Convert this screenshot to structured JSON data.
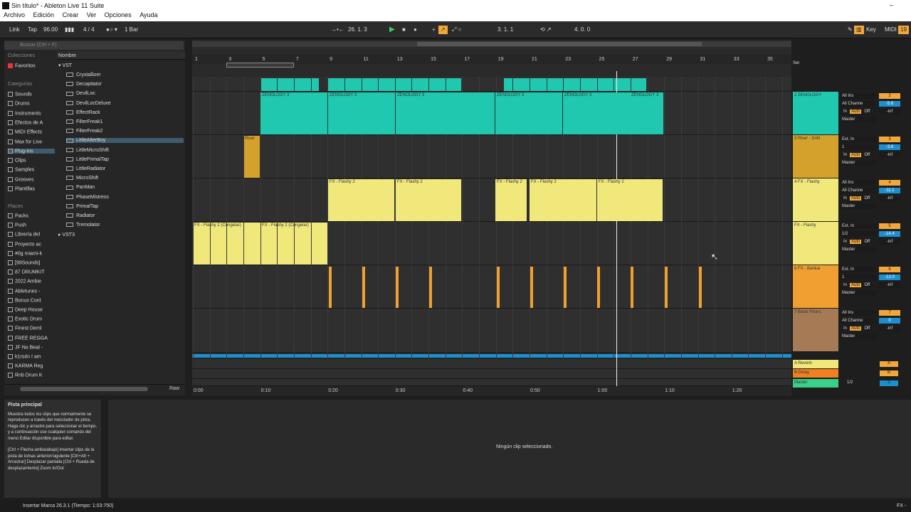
{
  "window": {
    "title": "Sin título* - Ableton Live 11 Suite"
  },
  "menu": [
    "Archivo",
    "Edición",
    "Crear",
    "Ver",
    "Opciones",
    "Ayuda"
  ],
  "transport": {
    "link": "Link",
    "tap": "Tap",
    "tempo": "96.00",
    "time_sig": "4 / 4",
    "quantize": "1 Bar",
    "position": "26.   1.   3",
    "loop_start": "3.   1.   1",
    "loop_length": "4.   0.   0",
    "key": "Key",
    "midi": "MIDI",
    "cpu": "19"
  },
  "browser": {
    "search_placeholder": "Buscar (Ctrl + F)",
    "collections_title": "Colecciones",
    "favorites": "Favoritos",
    "categories_title": "Categorías",
    "categories": [
      "Sounds",
      "Drums",
      "Instruments",
      "Efectos de A",
      "MIDI Effects",
      "Max for Live",
      "Plug-Ins",
      "Clips",
      "Samples",
      "Grooves",
      "Plantillas"
    ],
    "places_title": "Places",
    "places": [
      "Packs",
      "Push",
      "Librería del",
      "Proyecto ac",
      "#0g miami-k",
      "[99Sounds]",
      "87 DRUMKIT",
      "2022 Ambie",
      "Abletunes -",
      "Bonus Cont",
      "Deep House",
      "Exotic Drum",
      "Finest Deml",
      "FREE REGGA",
      "JF No Beat -",
      "k1rs4n I am",
      "KARMA Reg",
      "Rnb Drum K"
    ],
    "column_header": "Nombre",
    "vst_folder": "VST",
    "plugins": [
      "Crystallizer",
      "Decapitator",
      "DevilLoc",
      "DevilLocDeluxe",
      "EffectRack",
      "FilterFreak1",
      "FilterFreak2",
      "LittleAlterBoy",
      "LittleMicroShift",
      "LittlePrimalTap",
      "LittleRadiator",
      "MicroShift",
      "PanMan",
      "PhaseMistress",
      "PrimalTap",
      "Radiator",
      "Tremolator"
    ],
    "vst3_folder": "VST3",
    "raw": "Raw"
  },
  "ruler": [
    "1",
    "3",
    "5",
    "7",
    "9",
    "11",
    "13",
    "15",
    "17",
    "19",
    "21",
    "23",
    "25",
    "27",
    "29",
    "31",
    "33",
    "35"
  ],
  "time_ruler": [
    "0:00",
    "0:10",
    "0:20",
    "0:30",
    "0:40",
    "0:50",
    "1:00",
    "1:10",
    "1:20"
  ],
  "set_label": "Set",
  "tracks": [
    {
      "name": "2 ZENOLOGY",
      "input": "All Ins",
      "channel": "All Channe",
      "num": "2",
      "vol": "-5.6",
      "pan": "-inf",
      "color": "#20c8b0"
    },
    {
      "name": "3 Riser - Drilli",
      "input": "Ext. In",
      "channel": "1",
      "num": "3",
      "vol": "-3.6",
      "pan": "-inf",
      "color": "#d4a22c"
    },
    {
      "name": "4 FX - Flashy",
      "input": "All Ins",
      "channel": "All Channe",
      "num": "4",
      "vol": "-11.1",
      "pan": "-inf",
      "color": "#f0e87a"
    },
    {
      "name": "FX - Flashy",
      "input": "Ext. In",
      "channel": "1/2",
      "num": "5",
      "vol": "-14.4",
      "pan": "-inf",
      "color": "#f0e87a"
    },
    {
      "name": "6 FX - Bankai",
      "input": "Ext. In",
      "channel": "1",
      "num": "6",
      "vol": "-12.0",
      "pan": "-inf",
      "color": "#f0a030"
    },
    {
      "name": "7 Basic Fina-L",
      "input": "All Ins",
      "channel": "All Channe",
      "num": "7",
      "vol": "0",
      "pan": "-inf",
      "color": "#a57a55"
    }
  ],
  "io_labels": {
    "in": "In",
    "auto": "Auto",
    "off": "Off",
    "master": "Master"
  },
  "returns": [
    {
      "name": "A Reverb",
      "num": "A",
      "color": "#f0e87a"
    },
    {
      "name": "B Delay",
      "num": "B",
      "color": "#f08020"
    },
    {
      "name": "Master",
      "num": "0",
      "color": "#3ad08a",
      "channel": "1/2"
    }
  ],
  "clips": {
    "zenology": "ZENOLOGY 3",
    "riser": "Riser",
    "flashy": "FX - Flashy 2",
    "flashy_frozen": "FX - Flashy 2 (Congelar)"
  },
  "info": {
    "title": "Pista principal",
    "body": "Muestra todos los clips que normalmente se reproducen a través del mezclador de pista. Haga clic y arrastre para seleccionar el tiempo, y a continuación use cualquier comando del menú Editar disponible para editar.",
    "shortcuts": "[Ctrl + Flecha arriba/abajo] Insertar clips de la pista de tomas anterior/siguiente [Ctrl+Alt + Arrastrar] Desplazar pantalla [Ctrl + Rueda de desplazamiento] Zoom In/Out"
  },
  "detail": {
    "empty": "Ningún clip seleccionado."
  },
  "status": {
    "text": "Insertar Marca 26.3.1 (Tiempo: 1:03:750)",
    "right": "FX -"
  }
}
